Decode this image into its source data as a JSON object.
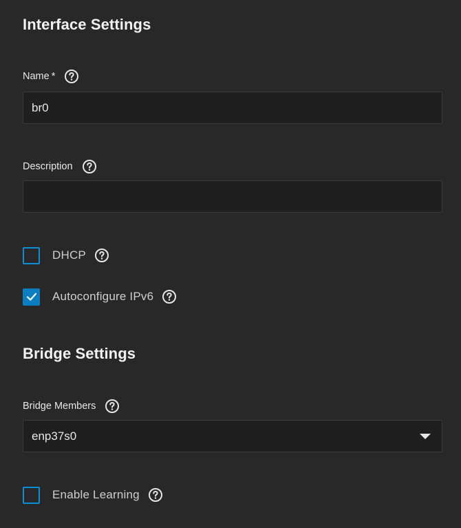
{
  "interface_settings": {
    "title": "Interface Settings",
    "name": {
      "label": "Name",
      "required_mark": "*",
      "value": "br0"
    },
    "description": {
      "label": "Description",
      "value": ""
    },
    "dhcp": {
      "label": "DHCP",
      "checked": false
    },
    "autoconfigure_ipv6": {
      "label": "Autoconfigure IPv6",
      "checked": true
    }
  },
  "bridge_settings": {
    "title": "Bridge Settings",
    "bridge_members": {
      "label": "Bridge Members",
      "value": "enp37s0"
    },
    "enable_learning": {
      "label": "Enable Learning",
      "checked": false
    }
  },
  "colors": {
    "background": "#282828",
    "input_background": "#1f1f1f",
    "accent": "#0a8fd6",
    "checked_fill": "#0a7ec0"
  },
  "icons": {
    "help": "help-circle-icon",
    "check": "checkmark-icon",
    "dropdown": "chevron-down-icon"
  }
}
